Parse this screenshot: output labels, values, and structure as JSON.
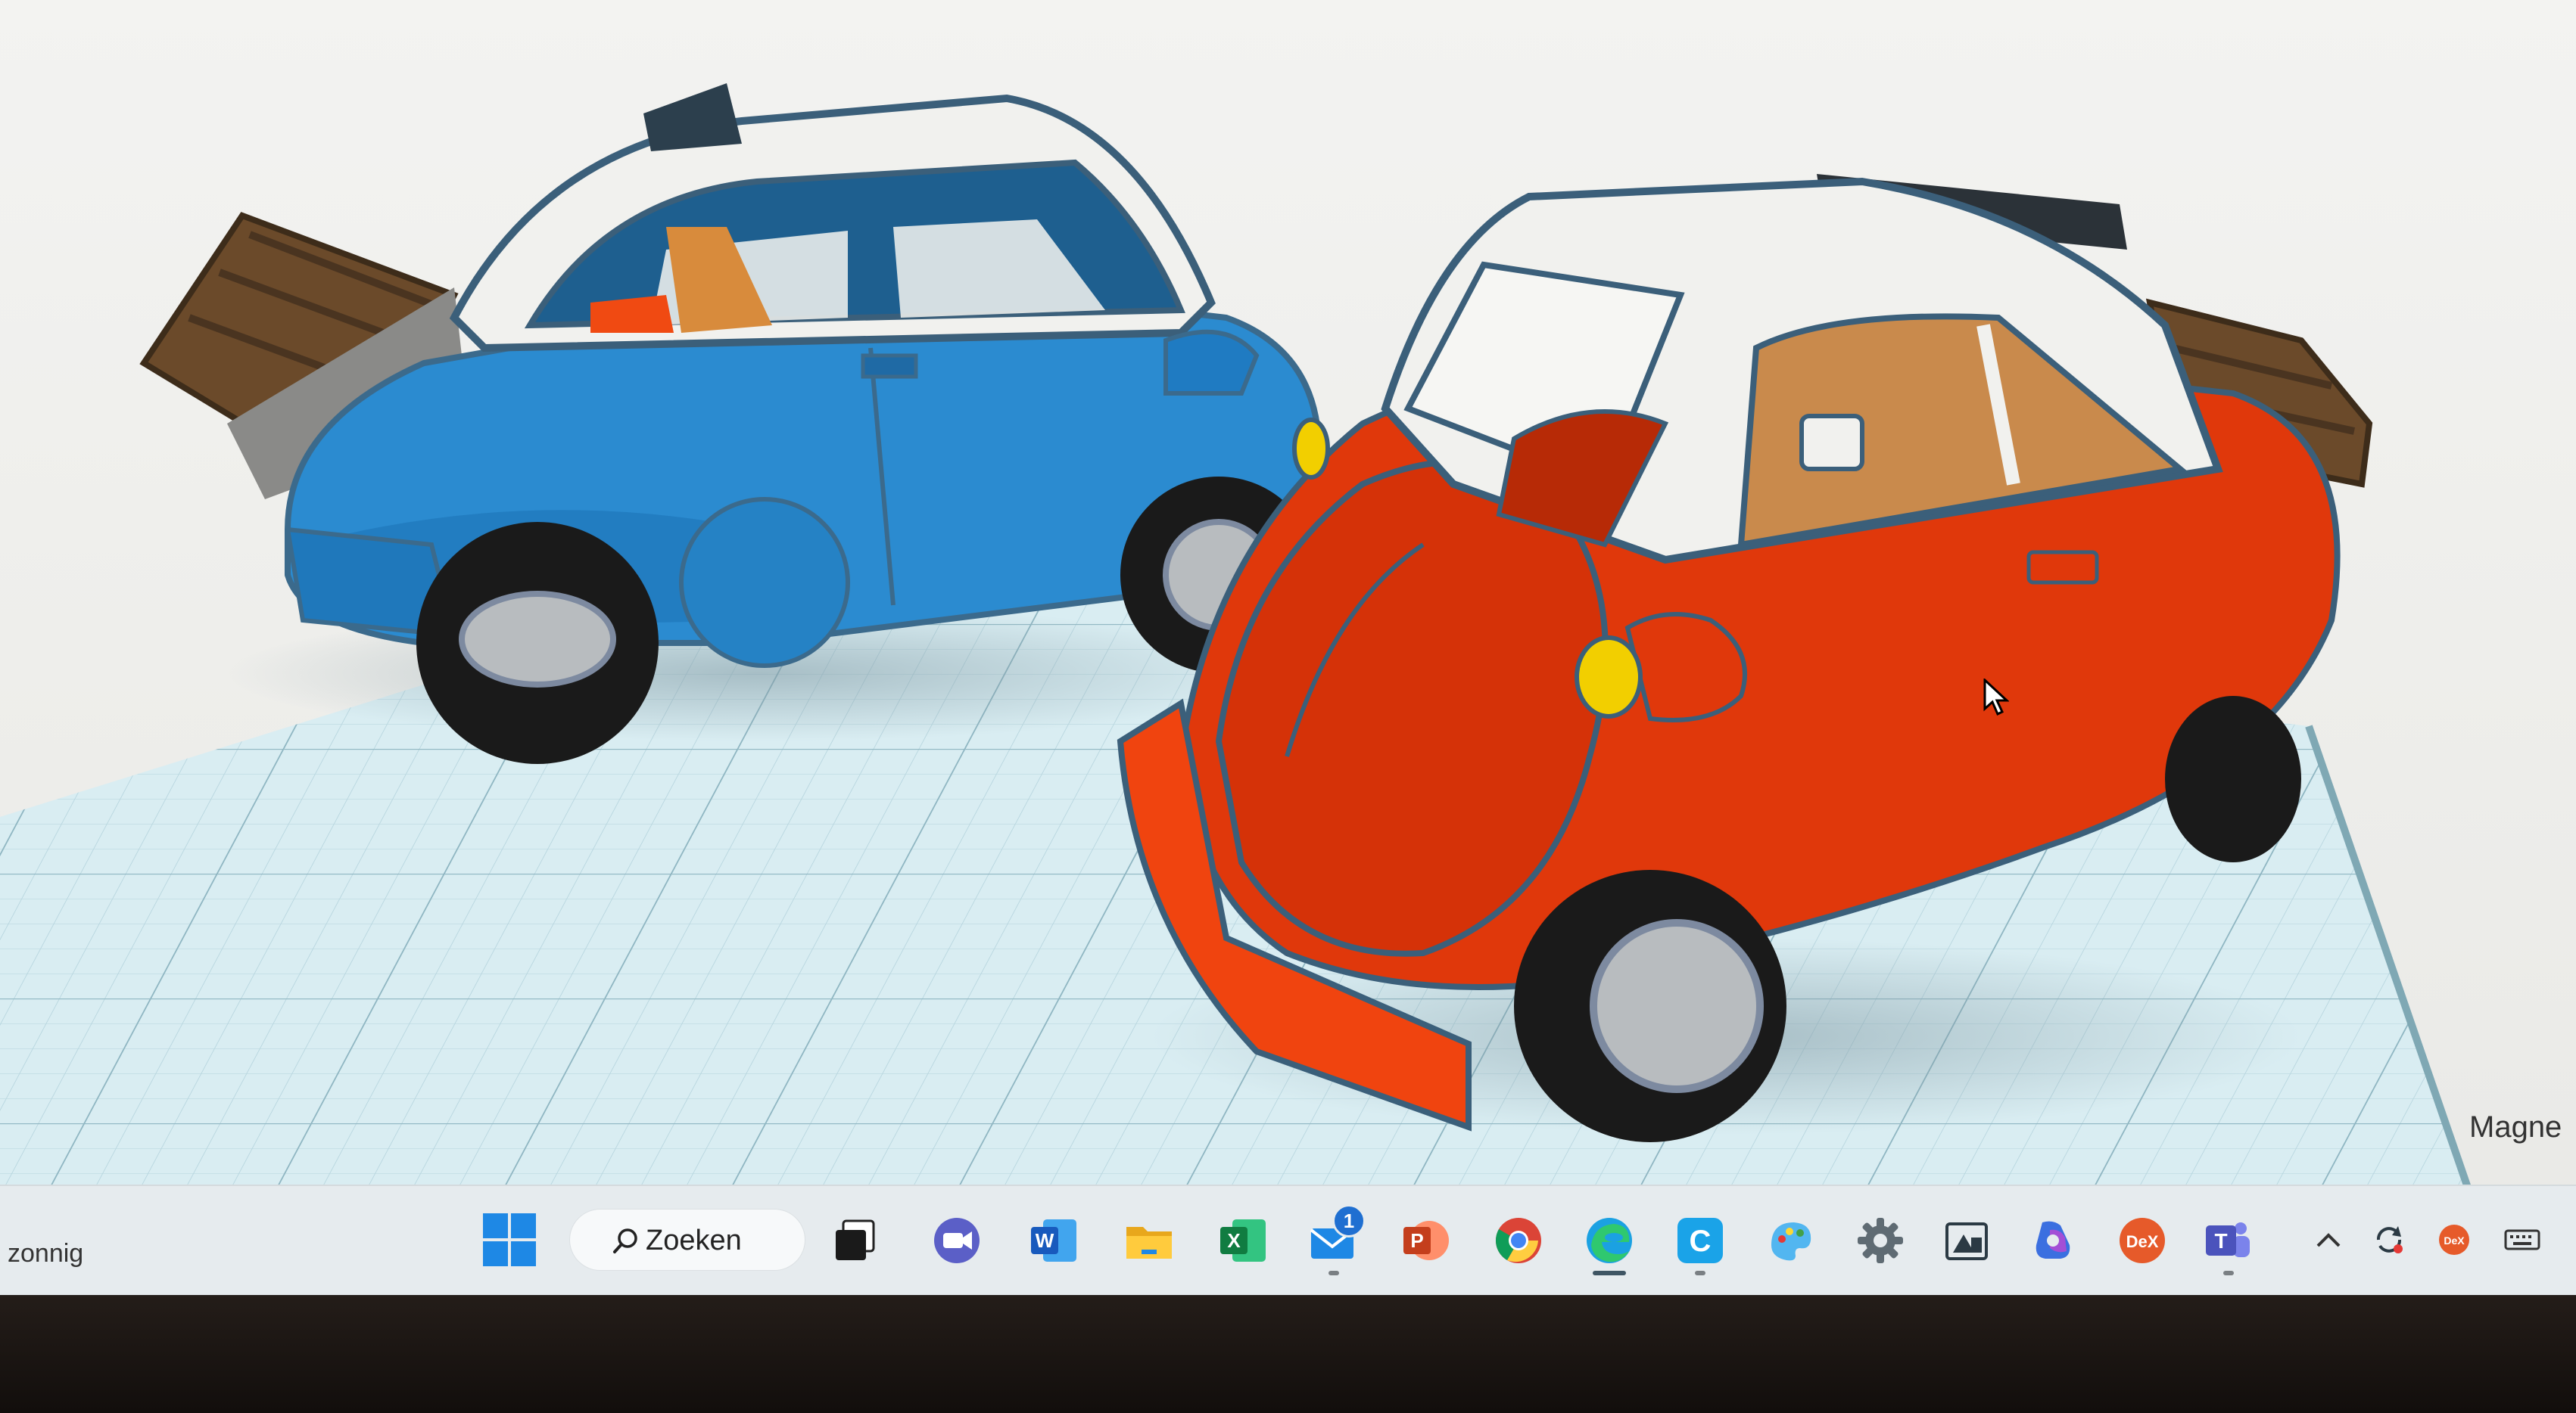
{
  "viewport": {
    "overlay_label": "Magne"
  },
  "taskbar": {
    "weather_text": "zonnig",
    "search_label": "Zoeken",
    "apps": [
      {
        "name": "Task View",
        "icon": "task-view-icon"
      },
      {
        "name": "Teams Meet",
        "icon": "video-call-icon"
      },
      {
        "name": "Word",
        "icon": "word-icon"
      },
      {
        "name": "File Explorer",
        "icon": "folder-icon"
      },
      {
        "name": "Excel",
        "icon": "excel-icon"
      },
      {
        "name": "Mail",
        "icon": "mail-icon",
        "badge": "1"
      },
      {
        "name": "PowerPoint",
        "icon": "powerpoint-icon"
      },
      {
        "name": "Chrome",
        "icon": "chrome-icon"
      },
      {
        "name": "Edge",
        "icon": "edge-icon"
      },
      {
        "name": "Clipchamp",
        "icon": "clipchamp-icon"
      },
      {
        "name": "Paint",
        "icon": "paint-icon"
      },
      {
        "name": "Settings",
        "icon": "gear-icon"
      },
      {
        "name": "Image Viewer",
        "icon": "image-icon"
      },
      {
        "name": "Copilot",
        "icon": "copilot-icon"
      },
      {
        "name": "DeX",
        "icon": "dex-icon",
        "label": "DeX"
      },
      {
        "name": "Teams",
        "icon": "teams-icon"
      }
    ],
    "tray": {
      "chevron_icon": "chevron-up-icon",
      "sync_icon": "sync-icon",
      "dex_icon": "dex-tray-icon",
      "dex_label": "DeX",
      "keyboard_icon": "keyboard-icon"
    }
  },
  "colors": {
    "blue_car": "#2b8bd0",
    "red_car": "#e0380b",
    "roof": "#f1f1ee",
    "grid": "#c9e1e8",
    "taskbar": "#e6ebee"
  }
}
